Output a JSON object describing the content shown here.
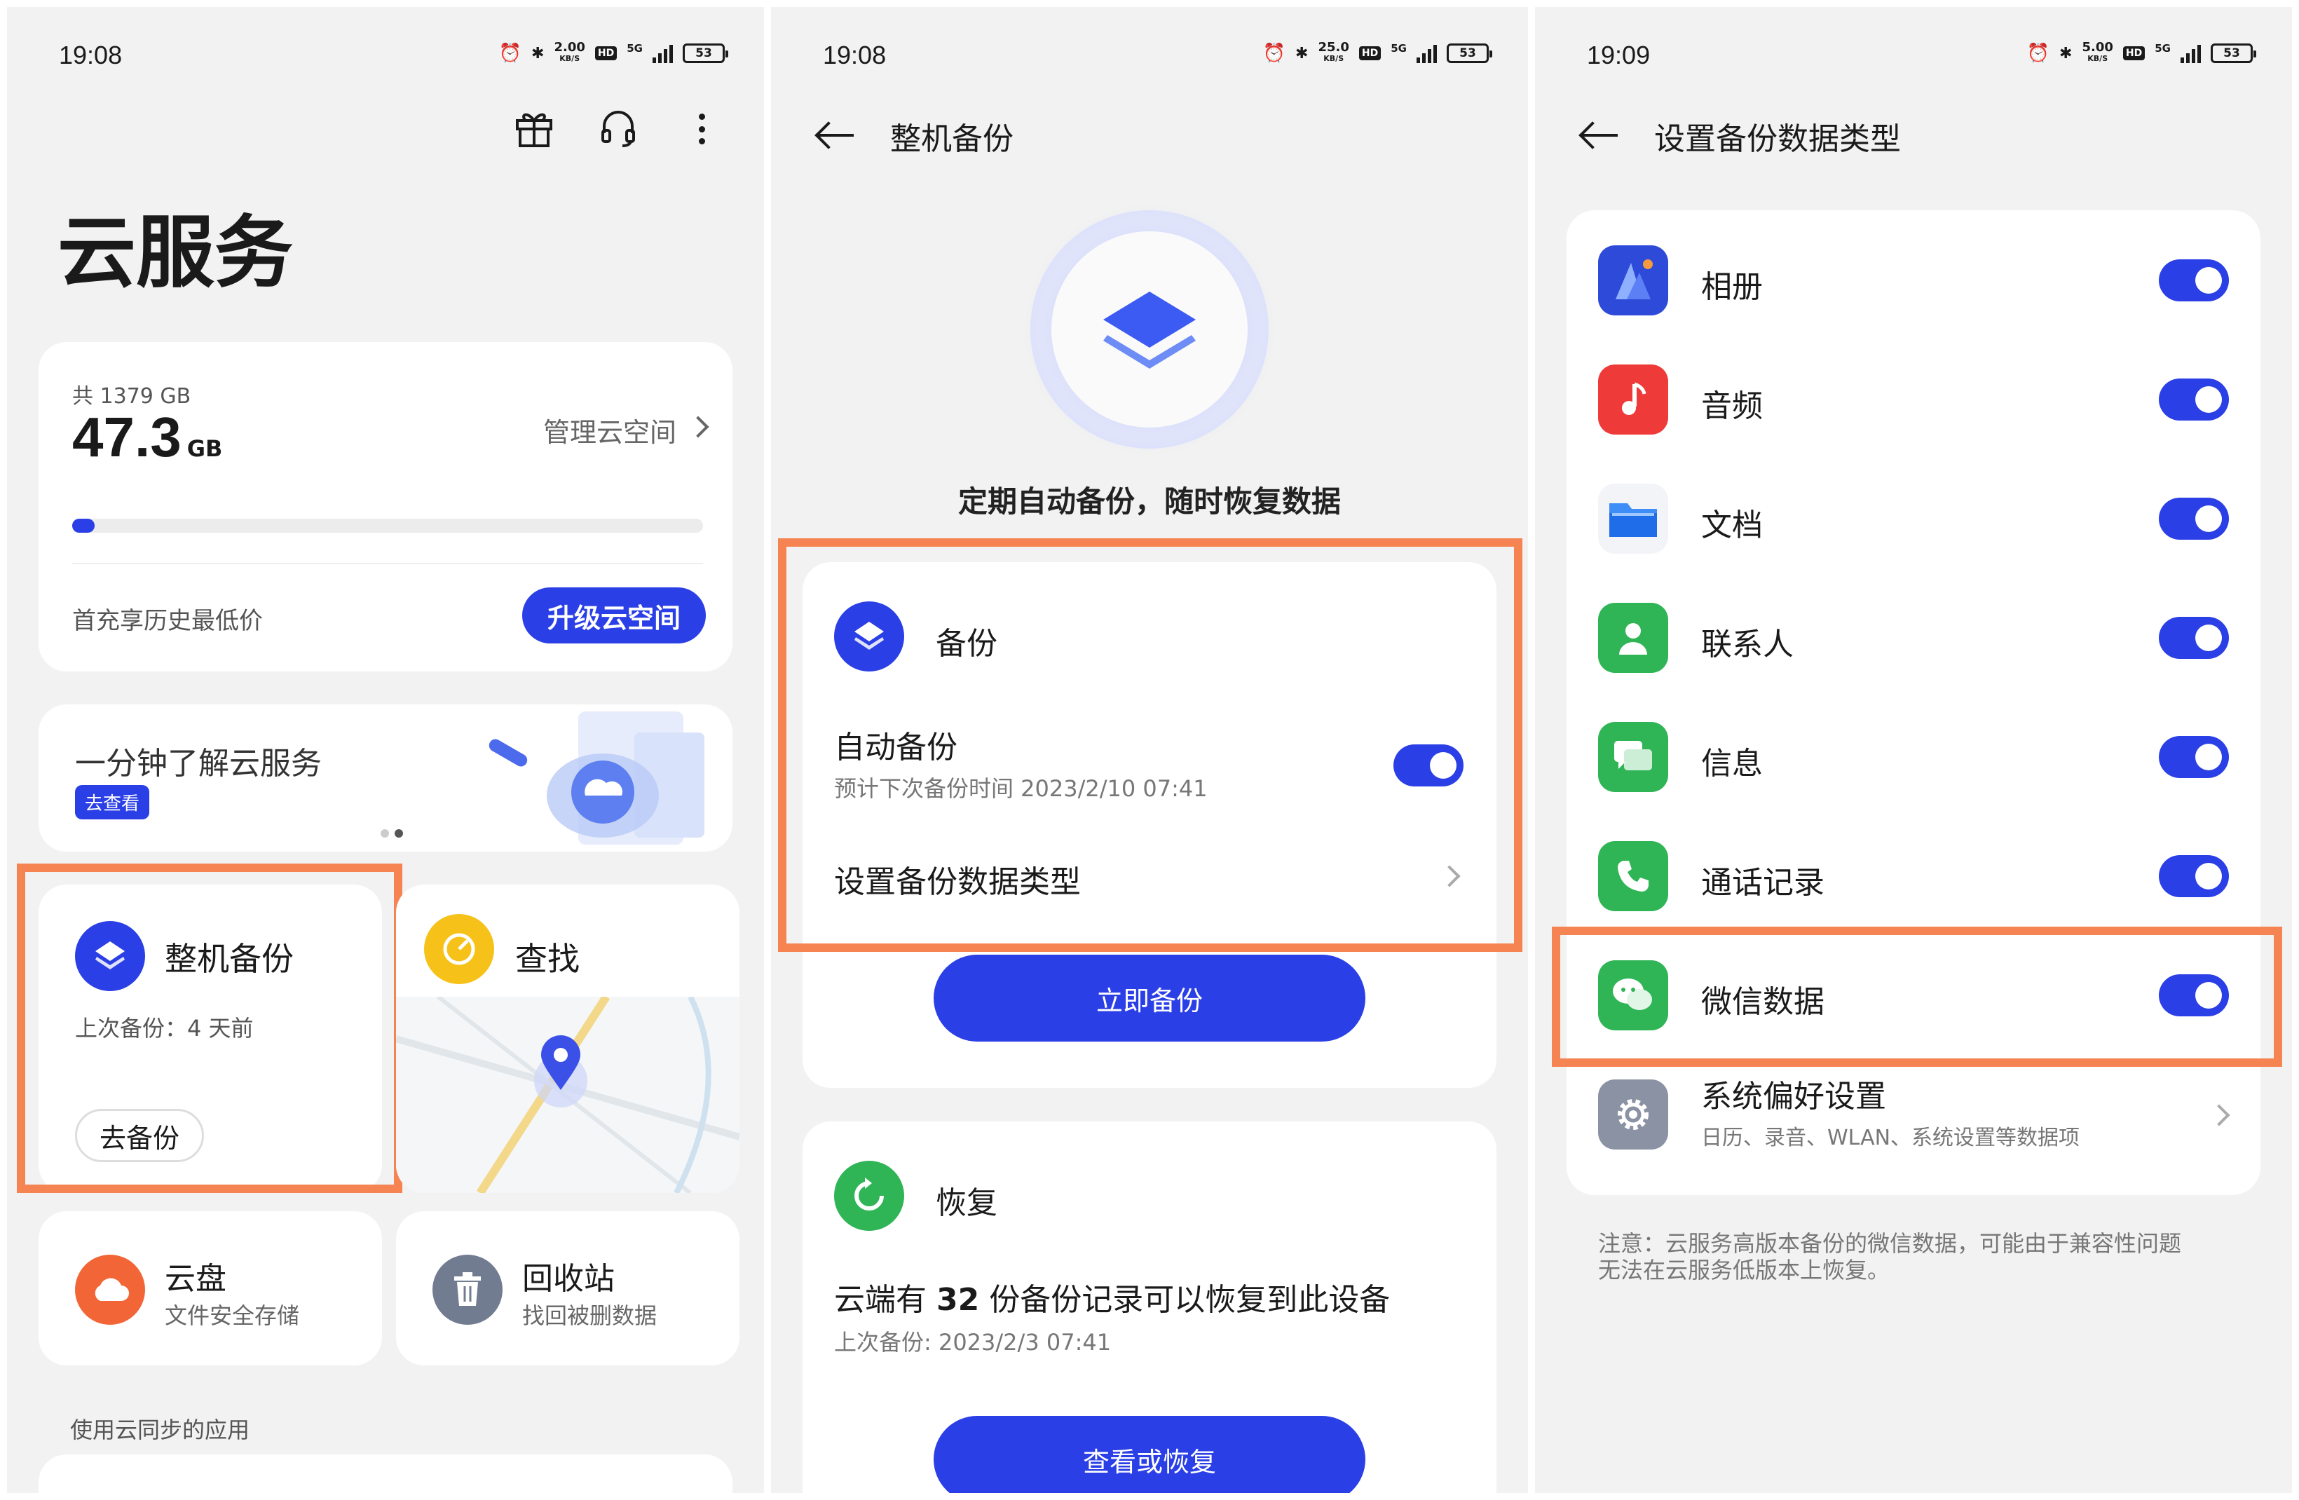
{
  "screen1": {
    "time": "19:08",
    "speed": "2.00",
    "speed_unit": "KB/S",
    "hd": "HD",
    "net": "5G",
    "battery": "53",
    "title": "云服务",
    "storage": {
      "total": "共 1379 GB",
      "used": "47.3",
      "used_unit": "GB",
      "manage": "管理云空间",
      "usage_fraction": 0.035,
      "promo": "首充享历史最低价",
      "upgrade": "升级云空间"
    },
    "banner": {
      "title": "一分钟了解云服务",
      "tag": "去查看"
    },
    "backup_tile": {
      "title": "整机备份",
      "last": "上次备份：4 天前",
      "button": "去备份"
    },
    "find_tile": {
      "title": "查找"
    },
    "drive_tile": {
      "title": "云盘",
      "sub": "文件安全存储"
    },
    "bin_tile": {
      "title": "回收站",
      "sub": "找回被删数据"
    },
    "sync_apps": "使用云同步的应用"
  },
  "screen2": {
    "time": "19:08",
    "speed": "25.0",
    "speed_unit": "KB/S",
    "hd": "HD",
    "net": "5G",
    "battery": "53",
    "title": "整机备份",
    "slogan": "定期自动备份，随时恢复数据",
    "backup": {
      "title": "备份",
      "auto": "自动备份",
      "next": "预计下次备份时间 2023/2/10 07:41",
      "types": "设置备份数据类型",
      "now": "立即备份"
    },
    "restore": {
      "title": "恢复",
      "prefix": "云端有 ",
      "count": "32",
      "suffix": " 份备份记录可以恢复到此设备",
      "last": "上次备份: 2023/2/3 07:41",
      "button": "查看或恢复"
    }
  },
  "screen3": {
    "time": "19:09",
    "speed": "5.00",
    "speed_unit": "KB/S",
    "hd": "HD",
    "net": "5G",
    "battery": "53",
    "title": "设置备份数据类型",
    "items": [
      {
        "label": "相册",
        "icon": "gallery-icon",
        "color": "#2e4ad8",
        "on": true
      },
      {
        "label": "音频",
        "icon": "music-icon",
        "color": "#ef3a3a",
        "on": true
      },
      {
        "label": "文档",
        "icon": "folder-icon",
        "color": "#1f7cf2",
        "on": true
      },
      {
        "label": "联系人",
        "icon": "contact-icon",
        "color": "#2fb556",
        "on": true
      },
      {
        "label": "信息",
        "icon": "message-icon",
        "color": "#2fb556",
        "on": true
      },
      {
        "label": "通话记录",
        "icon": "phone-icon",
        "color": "#2fb556",
        "on": true
      },
      {
        "label": "微信数据",
        "icon": "wechat-icon",
        "color": "#2fb556",
        "on": true
      }
    ],
    "system": {
      "label": "系统偏好设置",
      "sub": "日历、录音、WLAN、系统设置等数据项"
    },
    "note1": "注意：云服务高版本备份的微信数据，可能由于兼容性问题",
    "note2": "无法在云服务低版本上恢复。"
  }
}
